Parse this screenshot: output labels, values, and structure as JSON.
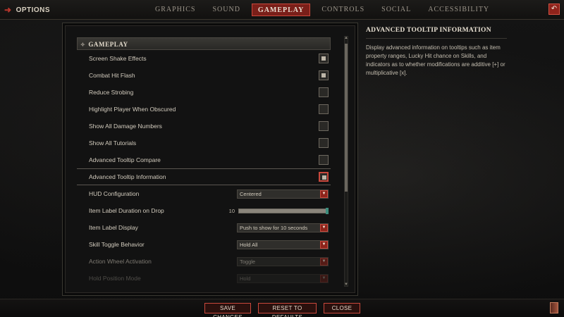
{
  "topbar": {
    "back_label": "OPTIONS",
    "tabs": [
      {
        "label": "GRAPHICS"
      },
      {
        "label": "SOUND"
      },
      {
        "label": "GAMEPLAY"
      },
      {
        "label": "CONTROLS"
      },
      {
        "label": "SOCIAL"
      },
      {
        "label": "ACCESSIBILITY"
      }
    ],
    "active_tab": "GAMEPLAY"
  },
  "panel": {
    "section_title": "GAMEPLAY",
    "checkbox_rows": [
      {
        "label": "Screen Shake Effects",
        "checked": true
      },
      {
        "label": "Combat Hit Flash",
        "checked": true
      },
      {
        "label": "Reduce Strobing",
        "checked": false
      },
      {
        "label": "Highlight Player When Obscured",
        "checked": false
      },
      {
        "label": "Show All Damage Numbers",
        "checked": false
      },
      {
        "label": "Show All Tutorials",
        "checked": false
      },
      {
        "label": "Advanced Tooltip Compare",
        "checked": false
      },
      {
        "label": "Advanced Tooltip Information",
        "checked": true,
        "selected": true
      }
    ],
    "hud_configuration": {
      "label": "HUD Configuration",
      "value": "Centered"
    },
    "item_label_duration": {
      "label": "Item Label Duration on Drop",
      "value": "10"
    },
    "item_label_display": {
      "label": "Item Label Display",
      "value": "Push to show for 10 seconds"
    },
    "skill_toggle_behavior": {
      "label": "Skill Toggle Behavior",
      "value": "Hold All"
    },
    "action_wheel_activation": {
      "label": "Action Wheel Activation",
      "value": "Toggle"
    },
    "hold_position_mode": {
      "label": "Hold Position Mode",
      "value": "Hold"
    }
  },
  "info": {
    "title": "ADVANCED TOOLTIP INFORMATION",
    "body": "Display advanced information on tooltips such as item property ranges, Lucky Hit chance on Skills, and indicators as to whether modifications are additive [+] or multiplicative [x]."
  },
  "bottom": {
    "save_label": "SAVE CHANGES",
    "reset_label": "RESET TO DEFAULTS",
    "close_label": "CLOSE"
  },
  "colors": {
    "accent_red": "#c9483c",
    "tab_active_bg": "#7a1f19",
    "background": "#0b0b0b"
  },
  "icons": [
    "back-arrow-icon",
    "reset-icon",
    "dropdown-arrow-icon",
    "book-icon"
  ]
}
